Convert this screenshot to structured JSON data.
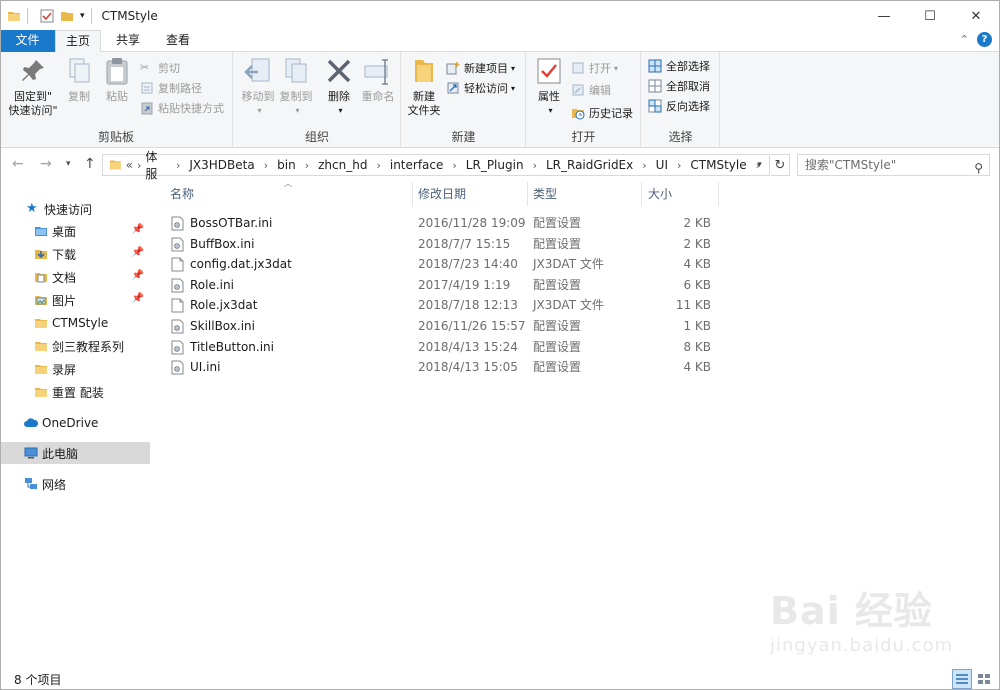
{
  "window": {
    "title": "CTMStyle",
    "minimize": "—",
    "maximize": "☐",
    "close": "✕"
  },
  "tabs": {
    "file": "文件",
    "home": "主页",
    "share": "共享",
    "view": "查看"
  },
  "ribbon": {
    "clipboard": {
      "label": "剪贴板",
      "pin_line1": "固定到\"",
      "pin_line2": "快速访问\"",
      "copy": "复制",
      "paste": "粘贴",
      "cut": "剪切",
      "copy_path": "复制路径",
      "paste_shortcut": "粘贴快捷方式"
    },
    "organize": {
      "label": "组织",
      "move_to": "移动到",
      "copy_to": "复制到",
      "delete": "删除",
      "rename": "重命名"
    },
    "new": {
      "label": "新建",
      "new_folder_line1": "新建",
      "new_folder_line2": "文件夹",
      "new_item": "新建项目",
      "easy_access": "轻松访问"
    },
    "open": {
      "label": "打开",
      "properties": "属性",
      "open": "打开",
      "edit": "编辑",
      "history": "历史记录"
    },
    "select": {
      "label": "选择",
      "select_all": "全部选择",
      "select_none": "全部取消",
      "invert": "反向选择"
    }
  },
  "address": {
    "overflow": "«",
    "crumbs": [
      "体服",
      "JX3HDBeta",
      "bin",
      "zhcn_hd",
      "interface",
      "LR_Plugin",
      "LR_RaidGridEx",
      "UI",
      "CTMStyle"
    ],
    "search_placeholder": "搜索\"CTMStyle\""
  },
  "nav": {
    "quick_access": "快速访问",
    "desktop": "桌面",
    "downloads": "下载",
    "documents": "文档",
    "pictures": "图片",
    "ctmstyle": "CTMStyle",
    "jian3": "剑三教程系列",
    "record": "录屏",
    "reset": "重置 配装",
    "onedrive": "OneDrive",
    "this_pc": "此电脑",
    "network": "网络"
  },
  "columns": {
    "name": "名称",
    "date": "修改日期",
    "type": "类型",
    "size": "大小"
  },
  "files": [
    {
      "name": "BossOTBar.ini",
      "date": "2016/11/28 19:09",
      "type": "配置设置",
      "size": "2 KB",
      "kind": "ini"
    },
    {
      "name": "BuffBox.ini",
      "date": "2018/7/7 15:15",
      "type": "配置设置",
      "size": "2 KB",
      "kind": "ini"
    },
    {
      "name": "config.dat.jx3dat",
      "date": "2018/7/23 14:40",
      "type": "JX3DAT 文件",
      "size": "4 KB",
      "kind": "dat"
    },
    {
      "name": "Role.ini",
      "date": "2017/4/19 1:19",
      "type": "配置设置",
      "size": "6 KB",
      "kind": "ini"
    },
    {
      "name": "Role.jx3dat",
      "date": "2018/7/18 12:13",
      "type": "JX3DAT 文件",
      "size": "11 KB",
      "kind": "dat"
    },
    {
      "name": "SkillBox.ini",
      "date": "2016/11/26 15:57",
      "type": "配置设置",
      "size": "1 KB",
      "kind": "ini"
    },
    {
      "name": "TitleButton.ini",
      "date": "2018/4/13 15:24",
      "type": "配置设置",
      "size": "8 KB",
      "kind": "ini"
    },
    {
      "name": "UI.ini",
      "date": "2018/4/13 15:05",
      "type": "配置设置",
      "size": "4 KB",
      "kind": "ini"
    }
  ],
  "status": {
    "count": "8 个项目"
  },
  "watermark": {
    "main": "Bai 经验",
    "sub": "jingyan.baidu.com"
  },
  "colors": {
    "accent": "#1979ca",
    "folder": "#e8b84a",
    "selected": "#d9d9d9"
  }
}
